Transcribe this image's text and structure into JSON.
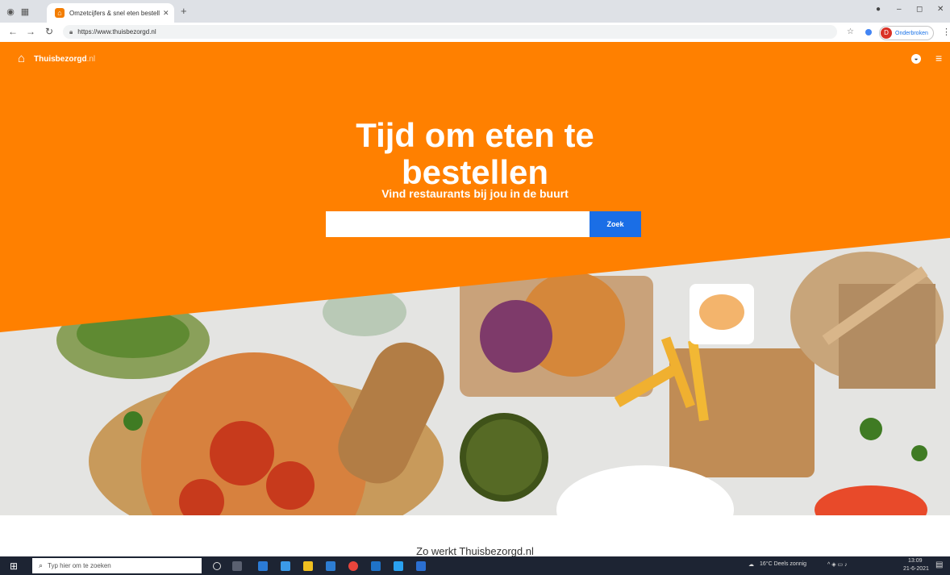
{
  "browser": {
    "tab_title": "Omzetcijfers & snel eten bestellen",
    "address": "https://www.thuisbezorgd.nl",
    "profile_label": "Onderbroken",
    "profile_initial": "D"
  },
  "site": {
    "logo_text": "Thuisbezorgd",
    "logo_tld": ".nl",
    "headline": "Tijd om eten te bestellen",
    "subheadline": "Vind restaurants bij jou in de buurt",
    "search": {
      "value": "",
      "placeholder": ""
    },
    "search_button": "Zoek",
    "section_title": "Zo werkt Thuisbezorgd.nl"
  },
  "taskbar": {
    "search_placeholder": "Typ hier om te zoeken",
    "weather": "16°C  Deels zonnig",
    "time": "13:09",
    "date": "21-6-2021"
  },
  "colors": {
    "brand_orange": "#ff8000",
    "search_button": "#1a6ee6"
  }
}
